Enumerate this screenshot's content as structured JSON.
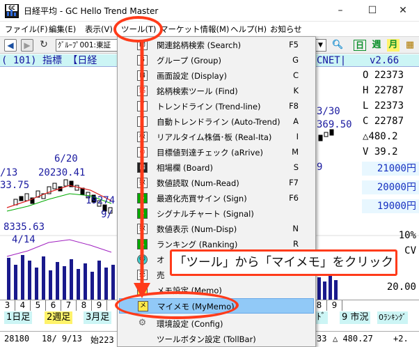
{
  "window": {
    "title": "日経平均 - GC Hello Trend Master",
    "minimize": "–",
    "maximize": "☐",
    "close": "✕"
  },
  "menubar": [
    {
      "label": "ファイル(F)"
    },
    {
      "label": "編集(E)"
    },
    {
      "label": "表示(V)"
    },
    {
      "label": "ツール(T)"
    },
    {
      "label": "マーケット情報(M)"
    },
    {
      "label": "ヘルプ(H)"
    },
    {
      "label": "お知らせ"
    }
  ],
  "toolbar": {
    "group_select_value": "ｸﾞﾙｰﾌﾟ001:東証",
    "daily_label": "日",
    "weekly_label": "週",
    "monthly_label": "月"
  },
  "chart": {
    "info_left": "(  101)  指標 【日経",
    "info_right": "CNET|",
    "version": "v2.66",
    "ohlc": [
      {
        "label": "O",
        "value": "22373"
      },
      {
        "label": "H",
        "value": "22787"
      },
      {
        "label": "L",
        "value": "22373"
      },
      {
        "label": "C",
        "value": "22787"
      },
      {
        "label": "△",
        "value": "480.2"
      },
      {
        "label": "V",
        "value": "39.2"
      }
    ],
    "price_ticks": [
      "21000円",
      "20000円",
      "19000円"
    ],
    "annotations": [
      {
        "text": "6/20"
      },
      {
        "text": "20230.41"
      },
      {
        "text": "/13"
      },
      {
        "text": "33.75"
      },
      {
        "text": "19274"
      },
      {
        "text": "9/"
      },
      {
        "text": "8335.63"
      },
      {
        "text": "4/14"
      },
      {
        "text": "3/30"
      },
      {
        "text": "369.50"
      },
      {
        "text": "9"
      }
    ],
    "right_values": [
      {
        "text": "10%"
      },
      {
        "text": "CV"
      },
      {
        "text": "20.00"
      }
    ],
    "dates": [
      "3",
      "4",
      "5",
      "6",
      "7",
      "8",
      "9"
    ],
    "dates_right": [
      "8",
      "9"
    ],
    "period_buttons": [
      {
        "num": "1",
        "label": "日足"
      },
      {
        "num": "2",
        "label": "週足"
      },
      {
        "num": "3",
        "label": "月足"
      }
    ],
    "right_buttons": [
      {
        "label": "ﾄﾞ"
      },
      {
        "num": "9",
        "label": "市況"
      },
      {
        "num": "0",
        "label": "ﾗﾝｷﾝｸﾞ"
      }
    ],
    "status": [
      {
        "text": "28180"
      },
      {
        "text": "18/ 9/13"
      },
      {
        "text": "始223"
      },
      {
        "text": "33"
      },
      {
        "text": "△ 480.27"
      },
      {
        "text": "+2."
      }
    ]
  },
  "tools_menu": [
    {
      "icon": "search-icon",
      "label": "関連銘柄検索 (Search)",
      "key": "F5"
    },
    {
      "icon": "group-icon",
      "label": "グループ (Group)",
      "key": "G"
    },
    {
      "icon": "display-icon",
      "label": "画面設定 (Display)",
      "key": "C"
    },
    {
      "icon": "find-icon",
      "label": "銘柄検索ツール (Find)",
      "key": "K"
    },
    {
      "icon": "trendline-icon",
      "label": "トレンドライン (Trend-line)",
      "key": "F8"
    },
    {
      "icon": "auto-trend-icon",
      "label": "自動トレンドライン (Auto-Trend)",
      "key": "A"
    },
    {
      "icon": "realtime-icon",
      "label": "リアルタイム株価･板 (Real-Ita)",
      "key": "I"
    },
    {
      "icon": "target-icon",
      "label": "目標値到達チェック (aRrive)",
      "key": "M"
    },
    {
      "icon": "board-icon",
      "label": "相場欄 (Board)",
      "key": "S"
    },
    {
      "icon": "numread-icon",
      "label": "数値読取 (Num-Read)",
      "key": "F7"
    },
    {
      "icon": "sign-icon",
      "label": "最適化売買サイン (Sign)",
      "key": "F6"
    },
    {
      "icon": "signal-icon",
      "label": "シグナルチャート (Signal)",
      "key": ""
    },
    {
      "icon": "numdisp-icon",
      "label": "数値表示 (Num-Disp)",
      "key": "N"
    },
    {
      "icon": "ranking-icon",
      "label": "ランキング (Ranking)",
      "key": "R"
    },
    {
      "icon": "smile-icon",
      "label": "オ",
      "key": ""
    },
    {
      "icon": "sell-icon",
      "label": "売",
      "key": ""
    },
    {
      "icon": "memo-icon",
      "label": "メモ設定 (Memo)",
      "key": ""
    },
    {
      "icon": "mymemo-icon",
      "label": "マイメモ (MyMemo)",
      "key": ""
    },
    {
      "icon": "config-icon",
      "label": "環境設定 (Config)",
      "key": ""
    },
    {
      "icon": "toolbar-icon",
      "label": "ツールボタン設定 (TollBar)",
      "key": ""
    }
  ],
  "callout": {
    "text": "「ツール」から「マイメモ」をクリック"
  },
  "colors": {
    "accent_red": "#ff3b1a",
    "highlight": "#91c9f7",
    "info_band": "#ccf5f5"
  }
}
